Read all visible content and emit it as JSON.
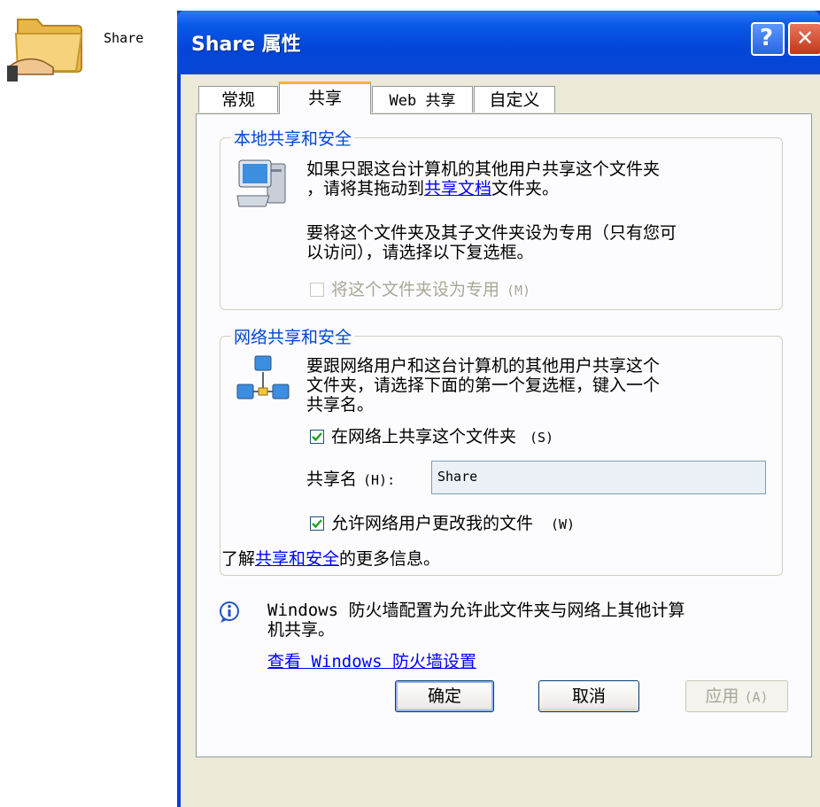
{
  "desktop": {
    "icon_label": "Share"
  },
  "window": {
    "title": "Share 属性",
    "help_label": "?",
    "close_label": "✕"
  },
  "tabs": [
    {
      "label": "常规"
    },
    {
      "label": "共享",
      "active": true
    },
    {
      "label": "Web 共享"
    },
    {
      "label": "自定义"
    }
  ],
  "local": {
    "legend": "本地共享和安全",
    "text_line1": "如果只跟这台计算机的其他用户共享这个文件夹",
    "text_line2_prefix": "，请将其拖动到",
    "link": "共享文档",
    "text_line2_suffix": "文件夹。",
    "private_line1": "要将这个文件夹及其子文件夹设为专用（只有您可",
    "private_line2": "以访问），请选择以下复选框。",
    "private_checkbox_label": "将这个文件夹设为专用",
    "private_checkbox_key": "(M)",
    "private_checked": false
  },
  "network": {
    "legend": "网络共享和安全",
    "text_line1": "要跟网络用户和这台计算机的其他用户共享这个",
    "text_line2": "文件夹，请选择下面的第一个复选框，键入一个",
    "text_line3": "共享名。",
    "share_checkbox_label": "在网络上共享这个文件夹",
    "share_checkbox_key": "(S)",
    "share_checked": true,
    "share_name_label": "共享名",
    "share_name_key": "(H):",
    "share_name_value": "Share",
    "allow_checkbox_label": "允许网络用户更改我的文件",
    "allow_checkbox_key": "(W)",
    "allow_checked": true,
    "learn_prefix": "了解",
    "learn_link": "共享和安全",
    "learn_suffix": "的更多信息。"
  },
  "firewall": {
    "info_line1": "Windows 防火墙配置为允许此文件夹与网络上其他计算",
    "info_line2": "机共享。",
    "link": "查看 Windows 防火墙设置"
  },
  "buttons": {
    "ok": "确定",
    "cancel": "取消",
    "apply": "应用",
    "apply_key": "(A)"
  },
  "colors": {
    "title_bar": "#0a5ae8",
    "group_legend": "#0046d5",
    "link": "#0000ff",
    "dialog_bg": "#ece9d8",
    "active_tab_accent": "#f4b33c"
  }
}
